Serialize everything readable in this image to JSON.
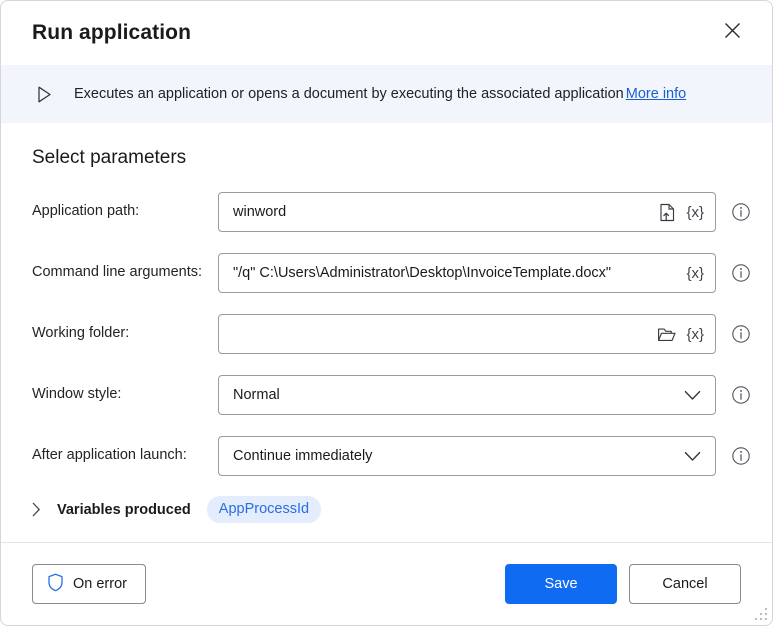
{
  "window": {
    "title": "Run application",
    "close_icon": "close-icon",
    "resize_grip": "resize-grip"
  },
  "banner": {
    "icon": "play-triangle-icon",
    "text": "Executes an application or opens a document by executing the associated application",
    "link_label": "More info",
    "background": "#f2f5fc",
    "link_color": "#1a5fd0"
  },
  "main": {
    "section_title": "Select parameters",
    "fields": [
      {
        "label": "Application path:",
        "value": "winword",
        "placeholder": "",
        "type": "text",
        "adornments": [
          "file-upload-icon",
          "variable-icon"
        ],
        "variable_glyph": "{x}",
        "info": "info-icon"
      },
      {
        "label": "Command line arguments:",
        "value": "\"/q\" C:\\Users\\Administrator\\Desktop\\InvoiceTemplate.docx\"",
        "placeholder": "",
        "type": "text",
        "adornments": [
          "variable-icon"
        ],
        "variable_glyph": "{x}",
        "info": "info-icon"
      },
      {
        "label": "Working folder:",
        "value": "",
        "placeholder": "",
        "type": "text",
        "adornments": [
          "folder-open-icon",
          "variable-icon"
        ],
        "variable_glyph": "{x}",
        "info": "info-icon"
      },
      {
        "label": "Window style:",
        "value": "Normal",
        "placeholder": "",
        "type": "dropdown",
        "adornments": [
          "chevron-down-icon"
        ],
        "variable_glyph": "",
        "info": "info-icon"
      },
      {
        "label": "After application launch:",
        "value": "Continue immediately",
        "placeholder": "",
        "type": "dropdown",
        "adornments": [
          "chevron-down-icon"
        ],
        "variable_glyph": "",
        "info": "info-icon"
      }
    ],
    "variables_produced": {
      "chevron_icon": "chevron-right-icon",
      "label": "Variables produced",
      "chips": [
        "AppProcessId"
      ],
      "chip_bg": "#e3edfd",
      "chip_color": "#2a6de0"
    }
  },
  "footer": {
    "on_error_label": "On error",
    "on_error_icon": "shield-icon",
    "save_label": "Save",
    "cancel_label": "Cancel",
    "save_color": "#0f6cf2"
  }
}
